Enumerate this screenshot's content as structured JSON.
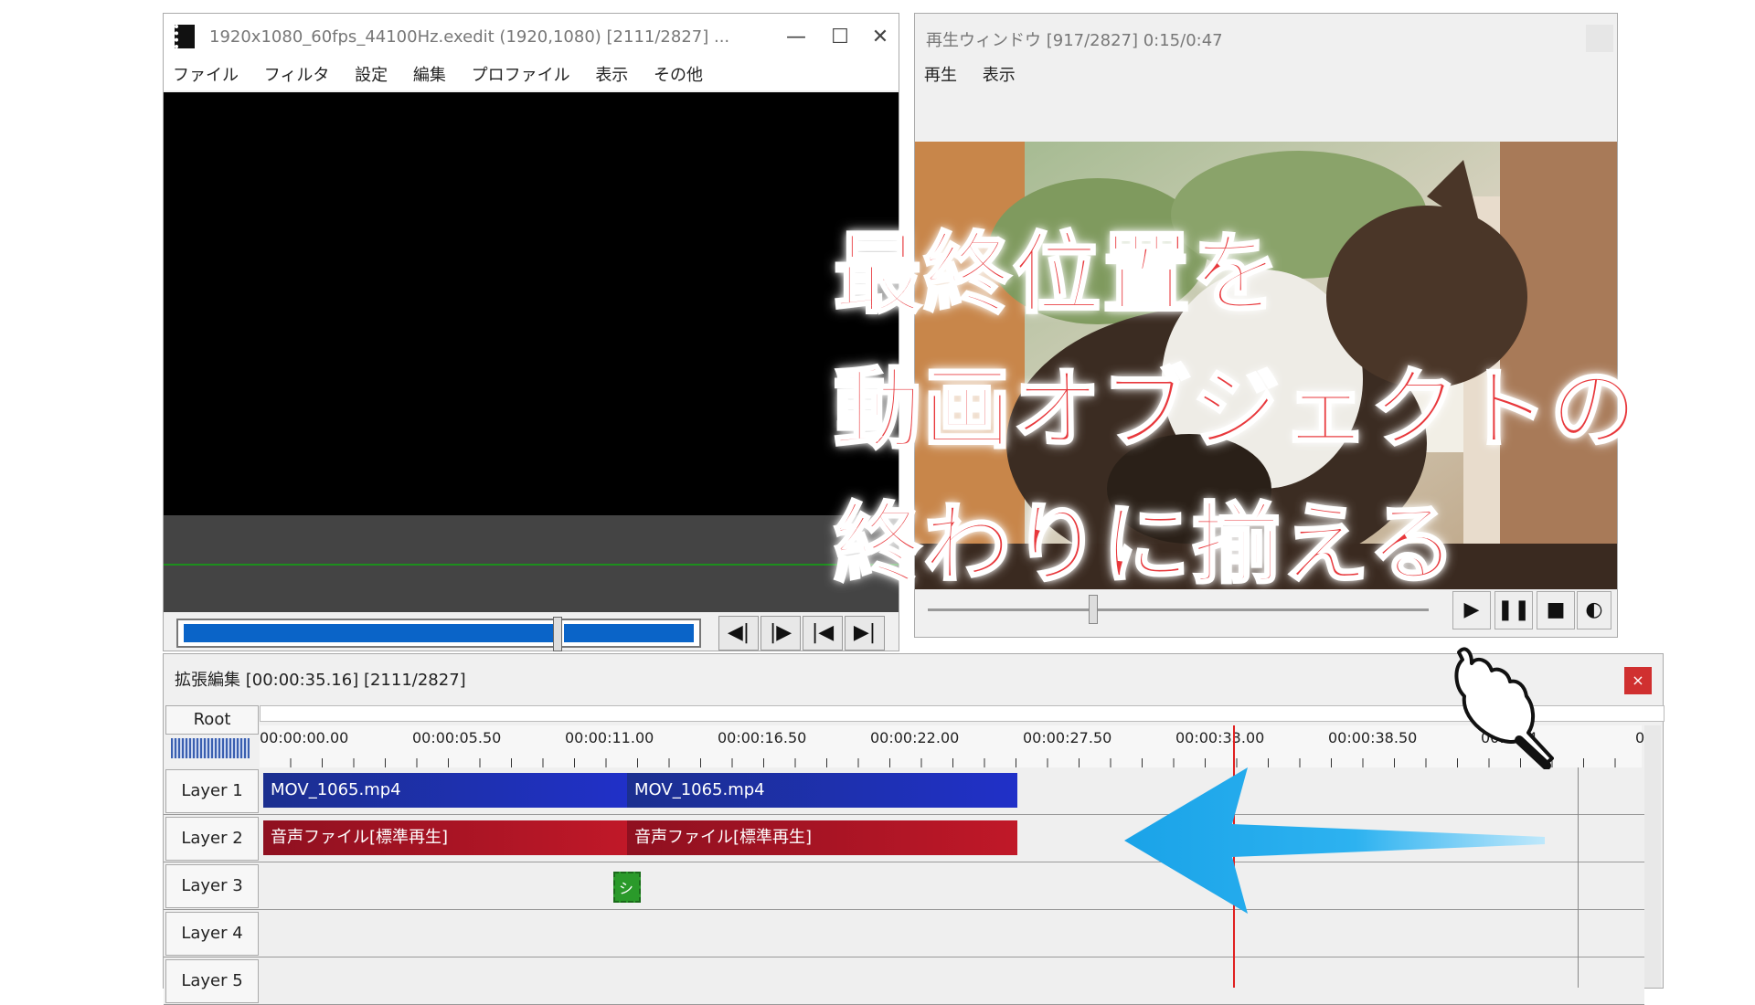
{
  "main_window": {
    "title": "1920x1080_60fps_44100Hz.exedit (1920,1080)  [2111/2827] ...",
    "menu": [
      "ファイル",
      "フィルタ",
      "設定",
      "編集",
      "プロファイル",
      "表示",
      "その他"
    ],
    "minimize_icon": "—",
    "maximize_icon": "☐",
    "close_icon": "✕",
    "controls": [
      "◀|",
      "|▶",
      "|◀",
      "▶|"
    ]
  },
  "play_window": {
    "title": "再生ウィンドウ  [917/2827]  0:15/0:47",
    "menu": [
      "再生",
      "表示"
    ],
    "buttons": [
      "▶",
      "❚❚",
      "■",
      "◐"
    ]
  },
  "timeline": {
    "title": "拡張編集 [00:00:35.16] [2111/2827]",
    "root_label": "Root",
    "close_label": "×",
    "ticks": [
      "00:00:00.00",
      "00:00:05.50",
      "00:00:11.00",
      "00:00:16.50",
      "00:00:22.00",
      "00:00:27.50",
      "00:00:33.00",
      "00:00:38.50",
      "00:00:4",
      "00"
    ],
    "layers": [
      "Layer  1",
      "Layer  2",
      "Layer  3",
      "Layer  4",
      "Layer  5"
    ],
    "clips": {
      "layer1_a": "MOV_1065.mp4",
      "layer1_b": "MOV_1065.mp4",
      "layer2_a": "音声ファイル[標準再生]",
      "layer2_b": "音声ファイル[標準再生]",
      "layer3_a": "シ"
    }
  },
  "caption": {
    "line1": "最終位置を",
    "line2": "動画オブジェクトの",
    "line3": "終わりに揃える"
  },
  "colors": {
    "caption_text": "#e8383c",
    "arrow": "#1aa3e8",
    "clip_blue": "#2030c8",
    "clip_red": "#c01828",
    "playhead": "#e02020"
  },
  "icons": {
    "arrow": "left-arrow-icon",
    "hand": "pointing-hand-icon",
    "film": "film-icon"
  }
}
